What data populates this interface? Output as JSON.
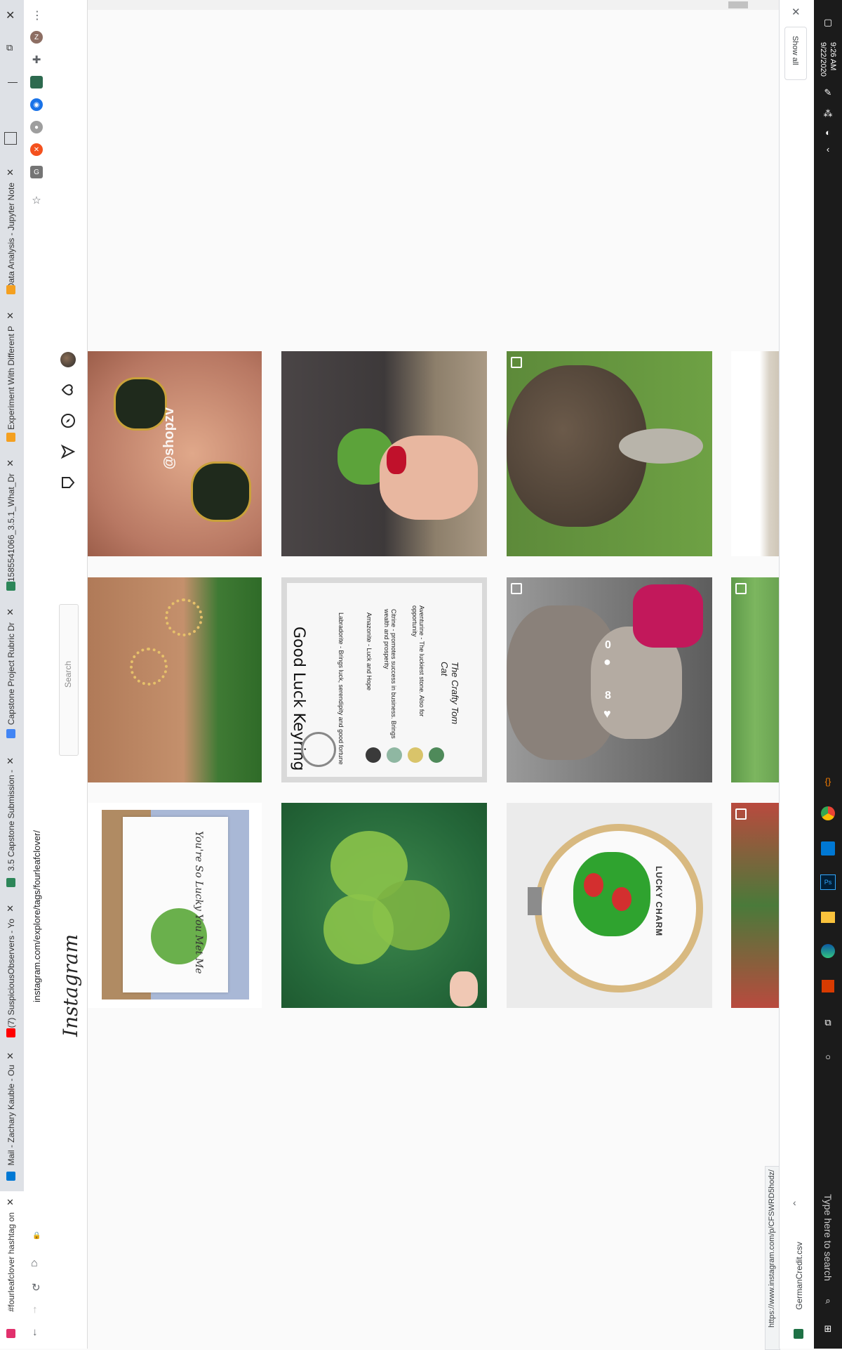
{
  "browser": {
    "tabs": [
      {
        "title": "#fourleafclover hashtag on",
        "color": "#e1306c",
        "active": true
      },
      {
        "title": "Mail - Zachary Kauble - Ou",
        "color": "#0078d4",
        "active": false
      },
      {
        "title": "(7) SuspiciousObservers - Yo",
        "color": "#ff0000",
        "active": false
      },
      {
        "title": "3.5 Capstone Submission -",
        "color": "#2d8659",
        "active": false
      },
      {
        "title": "Capstone Project Rubric Dr",
        "color": "#4285f4",
        "active": false
      },
      {
        "title": "1585541066_3.5.1_What_Dr",
        "color": "#2d8659",
        "active": false
      },
      {
        "title": "Experiment With Different P",
        "color": "#f4a020",
        "active": false
      },
      {
        "title": "Data Analysis - Jupyter Note",
        "color": "#f4a020",
        "active": false
      }
    ],
    "url": "instagram.com/explore/tags/fourleafclover/",
    "status_url": "https://www.instagram.com/p/CFSWRD5hodz/"
  },
  "instagram": {
    "logo": "Instagram",
    "search_placeholder": "Search",
    "posts": [
      {
        "alt": "clover necklace @shopzv",
        "caption": "@shopzv"
      },
      {
        "alt": "four leaf clover in hand"
      },
      {
        "alt": "bunny in grass"
      },
      {
        "alt": "flower necklace in palm"
      },
      {
        "alt": "Good Luck Keyring card",
        "heading": "Good Luck Keyring",
        "lines": [
          "Labradorite - Brings luck, serendipity and good fortune",
          "Amazonite - Luck and Hope",
          "Citrine - promotes success in business. Brings wealth and prosperity",
          "Aventurine - The luckiest stone. Also for opportunity"
        ],
        "brand": "The Crafty Tom Cat"
      },
      {
        "alt": "angel statue with purse",
        "likes": "8",
        "comments": "0"
      },
      {
        "alt": "You're So Lucky You Met Me card",
        "text": "You're So Lucky You Met Me"
      },
      {
        "alt": "four leaf clover held up"
      },
      {
        "alt": "ladybug cross stitch",
        "text": "LUCKY CHARM"
      }
    ]
  },
  "downloads": {
    "file": "GermanCredit.csv",
    "show_all": "Show all"
  },
  "taskbar": {
    "time": "9:26 AM",
    "date": "9/22/2020",
    "search_placeholder": "Type here to search"
  }
}
